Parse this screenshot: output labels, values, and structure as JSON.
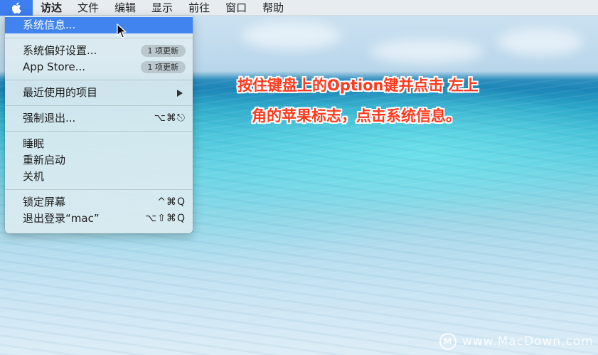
{
  "menubar": {
    "apple_icon": "apple-logo-icon",
    "menus": [
      "访达",
      "文件",
      "编辑",
      "显示",
      "前往",
      "窗口",
      "帮助"
    ]
  },
  "apple_menu": {
    "items": [
      {
        "label": "系统信息..."
      },
      {
        "label": "系统偏好设置...",
        "badge": "1 项更新"
      },
      {
        "label": "App Store...",
        "badge": "1 项更新"
      },
      {
        "label": "最近使用的项目",
        "submenu": "chevron-right"
      },
      {
        "label": "强制退出...",
        "shortcut": "⌥⌘⎋"
      },
      {
        "label": "睡眠"
      },
      {
        "label": "重新启动"
      },
      {
        "label": "关机"
      },
      {
        "label": "锁定屏幕",
        "shortcut": "^⌘Q"
      },
      {
        "label": "退出登录“mac”",
        "shortcut": "⌥⇧⌘Q"
      }
    ]
  },
  "annotation": {
    "line1": "按住键盘上的Option键并点击 左上",
    "line2": "角的苹果标志，点击系统信息。",
    "color": "#ff3a1e"
  },
  "watermark": {
    "logo": "M",
    "text": "www.MacDown.com"
  },
  "colors": {
    "highlight": "#4183ef",
    "menubar": "#e9edf1"
  }
}
